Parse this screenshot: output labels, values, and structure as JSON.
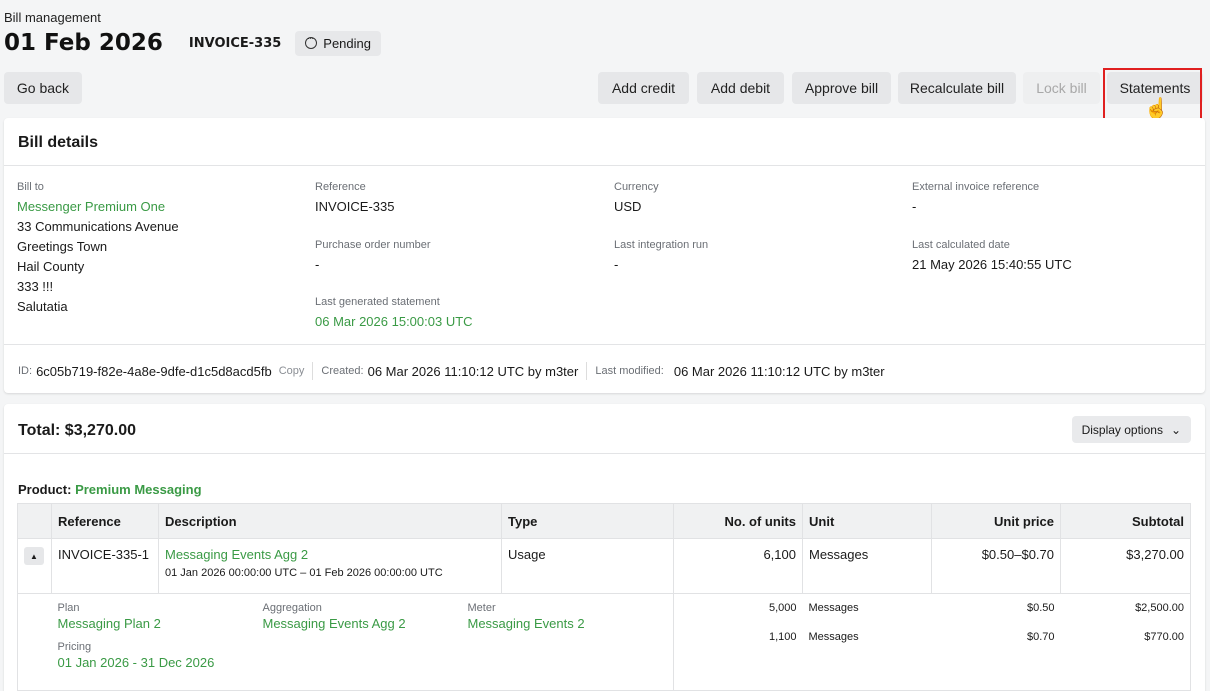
{
  "header": {
    "breadcrumb": "Bill management",
    "date": "01 Feb 2026",
    "invoice": "INVOICE-335",
    "status": "Pending"
  },
  "actions": {
    "go_back": "Go back",
    "add_credit": "Add credit",
    "add_debit": "Add debit",
    "approve": "Approve bill",
    "recalculate": "Recalculate bill",
    "lock": "Lock bill",
    "statements": "Statements"
  },
  "bill_details": {
    "title": "Bill details",
    "bill_to_label": "Bill to",
    "bill_to_name": "Messenger Premium One",
    "address": [
      "33 Communications Avenue",
      "Greetings Town",
      "Hail County",
      "333 !!!",
      "Salutatia"
    ],
    "reference_label": "Reference",
    "reference": "INVOICE-335",
    "po_label": "Purchase order number",
    "po": "-",
    "last_stmt_label": "Last generated statement",
    "last_stmt": "06 Mar 2026 15:00:03 UTC",
    "currency_label": "Currency",
    "currency": "USD",
    "integration_label": "Last integration run",
    "integration": "-",
    "ext_ref_label": "External invoice reference",
    "ext_ref": "-",
    "calc_label": "Last calculated date",
    "calc": "21 May 2026 15:40:55 UTC",
    "id_label": "ID:",
    "id": "6c05b719-f82e-4a8e-9dfe-d1c5d8acd5fb",
    "copy": "Copy",
    "created_label": "Created:",
    "created": "06 Mar 2026 11:10:12 UTC by m3ter",
    "modified_label": "Last modified:",
    "modified": "06 Mar 2026 11:10:12 UTC by m3ter"
  },
  "totals": {
    "total": "Total: $3,270.00",
    "display_options": "Display options",
    "product_label": "Product:",
    "product": "Premium Messaging"
  },
  "table": {
    "headers": [
      "Reference",
      "Description",
      "Type",
      "No. of units",
      "Unit",
      "Unit price",
      "Subtotal"
    ],
    "row": {
      "reference": "INVOICE-335-1",
      "description": "Messaging Events Agg 2",
      "period": "01 Jan 2026 00:00:00 UTC – 01 Feb 2026 00:00:00 UTC",
      "type": "Usage",
      "units": "6,100",
      "unit": "Messages",
      "unit_price": "$0.50–$0.70",
      "subtotal": "$3,270.00"
    },
    "detail": {
      "plan_label": "Plan",
      "plan": "Messaging Plan 2",
      "agg_label": "Aggregation",
      "agg": "Messaging Events Agg 2",
      "meter_label": "Meter",
      "meter": "Messaging Events 2",
      "pricing_label": "Pricing",
      "pricing": "01 Jan 2026 - 31 Dec 2026",
      "tiers": [
        {
          "units": "5,000",
          "unit": "Messages",
          "price": "$0.50",
          "subtotal": "$2,500.00"
        },
        {
          "units": "1,100",
          "unit": "Messages",
          "price": "$0.70",
          "subtotal": "$770.00"
        }
      ]
    }
  }
}
